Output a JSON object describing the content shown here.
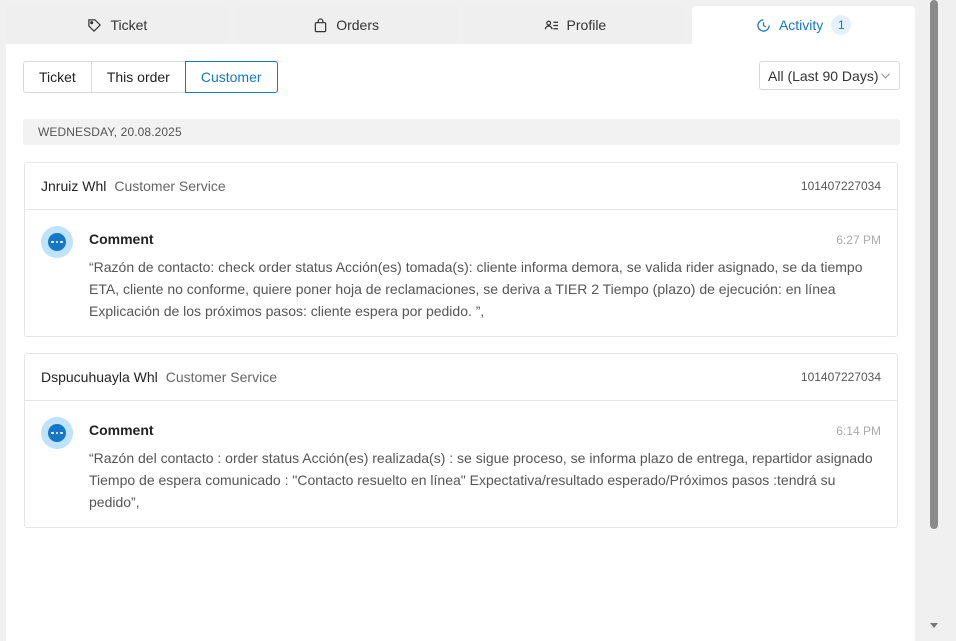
{
  "tabs": [
    {
      "label": "Ticket",
      "icon": "tag-icon"
    },
    {
      "label": "Orders",
      "icon": "shopping-bag-icon"
    },
    {
      "label": "Profile",
      "icon": "profile-list-icon"
    },
    {
      "label": "Activity",
      "icon": "clock-icon",
      "badge": "1",
      "active": true
    }
  ],
  "segments": [
    {
      "label": "Ticket"
    },
    {
      "label": "This order"
    },
    {
      "label": "Customer",
      "active": true
    }
  ],
  "filter": {
    "value": "All (Last 90 Days)"
  },
  "date_header": "WEDNESDAY, 20.08.2025",
  "entries": [
    {
      "agent": "Jnruiz Whl",
      "role": "Customer Service",
      "id": "101407227034",
      "type": "Comment",
      "time": "6:27 PM",
      "text": "“Razón de contacto: check order status Acción(es) tomada(s): cliente informa demora, se valida rider asignado, se da tiempo ETA, cliente no conforme, quiere poner hoja de reclamaciones, se deriva a TIER 2 Tiempo (plazo) de ejecución: en línea Explicación de los próximos pasos: cliente espera por pedido. ”,"
    },
    {
      "agent": "Dspucuhuayla Whl",
      "role": "Customer Service",
      "id": "101407227034",
      "type": "Comment",
      "time": "6:14 PM",
      "text": "“Razón del contacto : order status Acción(es) realizada(s) : se sigue proceso, se informa plazo de entrega, repartidor asignado Tiempo de espera comunicado : \"Contacto resuelto en línea\" Expectativa/resultado esperado/Próximos pasos :tendrá su pedido”,"
    }
  ],
  "colors": {
    "accent": "#1677c9",
    "avatar_bg": "#bfe3fb",
    "badge_bg": "#e4f1fb"
  }
}
